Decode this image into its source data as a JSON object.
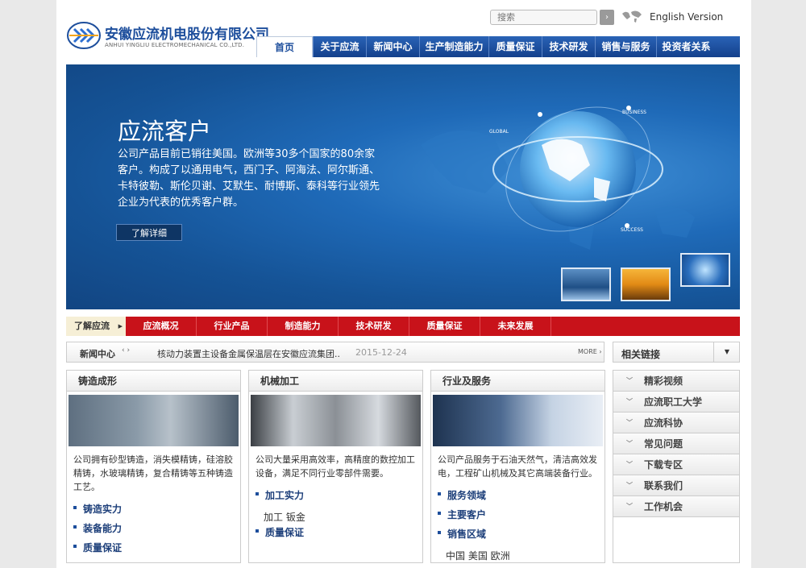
{
  "header": {
    "company_cn": "安徽应流机电股份有限公司",
    "company_en": "ANHUI YINGLIU ELECTROMECHANICAL CO.,LTD.",
    "search_placeholder": "搜索",
    "search_btn": "›",
    "language": "English Version"
  },
  "nav": [
    {
      "label": "首页",
      "active": true
    },
    {
      "label": "关于应流"
    },
    {
      "label": "新闻中心"
    },
    {
      "label": "生产制造能力"
    },
    {
      "label": "质量保证"
    },
    {
      "label": "技术研发"
    },
    {
      "label": "销售与服务"
    },
    {
      "label": "投资者关系"
    }
  ],
  "banner": {
    "title": "应流客户",
    "text": "公司产品目前已销往美国。欧洲等30多个国家的80余家客户。构成了以通用电气，西门子、阿海法、阿尔斯通、卡特彼勒、斯伦贝谢、艾默生、耐博斯、泰科等行业领先企业为代表的优秀客户群。",
    "button": "了解详细",
    "globe_labels": [
      "GLOBAL",
      "BUSINESS",
      "SUCCESS"
    ]
  },
  "redbar": {
    "first": "了解应流",
    "items": [
      "应流概况",
      "行业产品",
      "制造能力",
      "技术研发",
      "质量保证",
      "未来发展"
    ]
  },
  "news": {
    "label": "新闻中心",
    "arrows": "‹ ›",
    "headline": "核动力装置主设备金属保温层在安徽应流集团..",
    "date": "2015-12-24",
    "more": "MORE ›"
  },
  "links": {
    "title": "相关链接"
  },
  "columns": [
    {
      "title": "铸造成形",
      "desc": "公司拥有砂型铸造，消失模精铸，硅溶胶精铸，水玻璃精铸，复合精铸等五种铸造工艺。",
      "links": [
        "铸造实力",
        "装备能力",
        "质量保证"
      ]
    },
    {
      "title": "机械加工",
      "desc": "公司大量采用高效率，高精度的数控加工设备，满足不同行业零部件需要。",
      "links": [
        "加工实力"
      ],
      "plain": "加工  钣金",
      "links2": [
        "质量保证"
      ]
    },
    {
      "title": "行业及服务",
      "desc": "公司产品服务于石油天然气，清洁高效发电，工程矿山机械及其它高端装备行业。",
      "links": [
        "服务领域",
        "主要客户",
        "销售区域"
      ],
      "plain": "中国  美国  欧洲"
    }
  ],
  "sidebar": [
    "精彩视频",
    "应流职工大学",
    "应流科协",
    "常见问题",
    "下载专区",
    "联系我们",
    "工作机会"
  ],
  "colors": {
    "nav": "#1d4e9c",
    "red": "#c8121a"
  }
}
